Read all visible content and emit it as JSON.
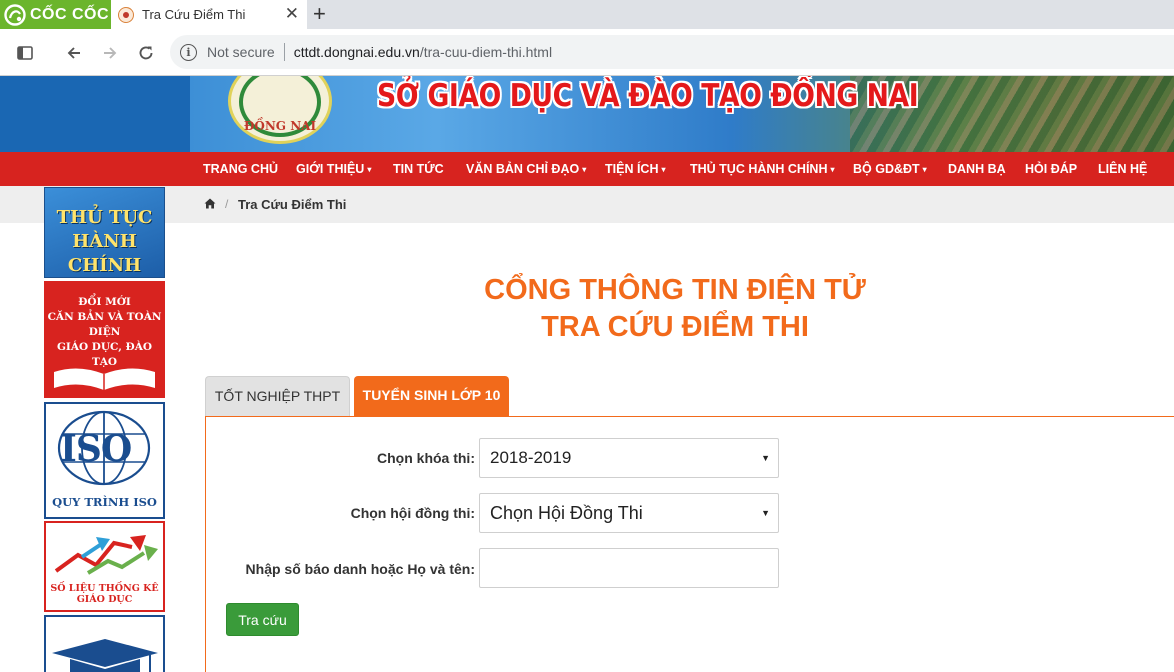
{
  "browser": {
    "brand": "CỐC CỐC",
    "tab_title": "Tra Cứu Điểm Thi",
    "new_tab": "+",
    "close": "✕",
    "security_label": "Not secure",
    "url_host": "cttdt.dongnai.edu.vn",
    "url_path": "/tra-cuu-diem-thi.html"
  },
  "header": {
    "emblem_text": "ĐỒNG NAI",
    "title": "SỞ GIÁO DỤC VÀ ĐÀO TẠO ĐỒNG NAI"
  },
  "nav": {
    "items": [
      {
        "label": "TRANG CHỦ"
      },
      {
        "label": "GIỚI THIỆU"
      },
      {
        "label": "TIN TỨC"
      },
      {
        "label": "VĂN BẢN CHỈ ĐẠO"
      },
      {
        "label": "TIỆN ÍCH"
      },
      {
        "label": "THỦ TỤC HÀNH CHÍNH"
      },
      {
        "label": "BỘ GD&ĐT"
      },
      {
        "label": "DANH BẠ"
      },
      {
        "label": "HỎI ĐÁP"
      },
      {
        "label": "LIÊN HỆ"
      }
    ],
    "caret": "▾"
  },
  "breadcrumb": {
    "separator": "/",
    "current": "Tra Cứu Điểm Thi"
  },
  "sidebar": {
    "admin_procedures": [
      "THỦ TỤC",
      "HÀNH CHÍNH"
    ],
    "reform": [
      "ĐỔI MỚI",
      "CĂN BẢN VÀ TOÀN DIỆN",
      "GIÁO DỤC, ĐÀO TẠO"
    ],
    "iso_logo": "ISO",
    "iso_caption": "QUY TRÌNH ISO",
    "statistics": [
      "SỐ LIỆU THỐNG KÊ",
      "GIÁO DỤC"
    ]
  },
  "main": {
    "title_line1": "CỔNG THÔNG TIN ĐIỆN TỬ",
    "title_line2": "TRA CỨU ĐIỂM THI",
    "tabs": [
      {
        "label": "TỐT NGHIỆP THPT",
        "active": false
      },
      {
        "label": "TUYỂN SINH LỚP 10",
        "active": true
      }
    ]
  },
  "form": {
    "exam_year_label": "Chọn khóa thi:",
    "exam_year_value": "2018-2019",
    "council_label": "Chọn hội đồng thi:",
    "council_value": "Chọn Hội Đồng Thi",
    "search_label": "Nhập số báo danh hoặc Họ và tên:",
    "search_value": "",
    "search_placeholder": "",
    "submit_label": "Tra cứu",
    "select_caret": "▼"
  },
  "colors": {
    "accent_orange": "#f26a1b",
    "nav_red": "#d7231f",
    "button_green": "#3a9b3a",
    "brand_green": "#6bb52c"
  }
}
